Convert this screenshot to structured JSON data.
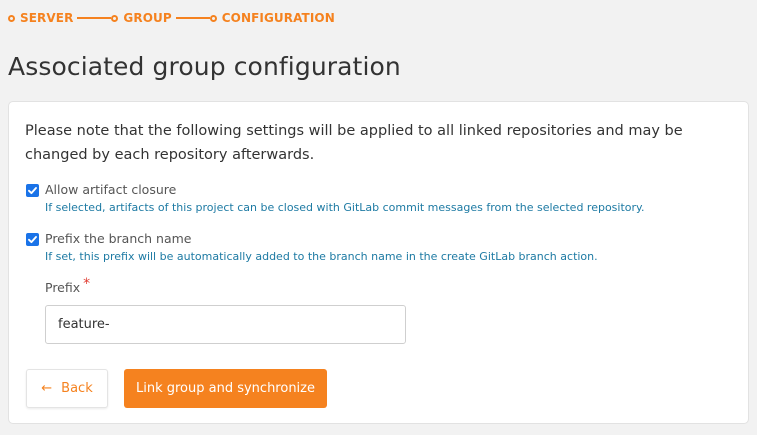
{
  "stepper": {
    "steps": [
      {
        "label": "SERVER"
      },
      {
        "label": "GROUP"
      },
      {
        "label": "CONFIGURATION"
      }
    ],
    "accent_color": "#f5821f"
  },
  "page": {
    "title": "Associated group configuration"
  },
  "form": {
    "intro": "Please note that the following settings will be applied to all linked repositories and may be changed by each repository afterwards.",
    "options": [
      {
        "label": "Allow artifact closure",
        "hint": "If selected, artifacts of this project can be closed with GitLab commit messages from the selected repository.",
        "checked": true
      },
      {
        "label": "Prefix the branch name",
        "hint": "If set, this prefix will be automatically added to the branch name in the create GitLab branch action.",
        "checked": true
      }
    ],
    "prefix": {
      "label": "Prefix",
      "required_marker": "*",
      "value": "feature-"
    },
    "back_label": "Back",
    "back_icon": "arrow-left-icon",
    "submit_label": "Link group and synchronize"
  }
}
